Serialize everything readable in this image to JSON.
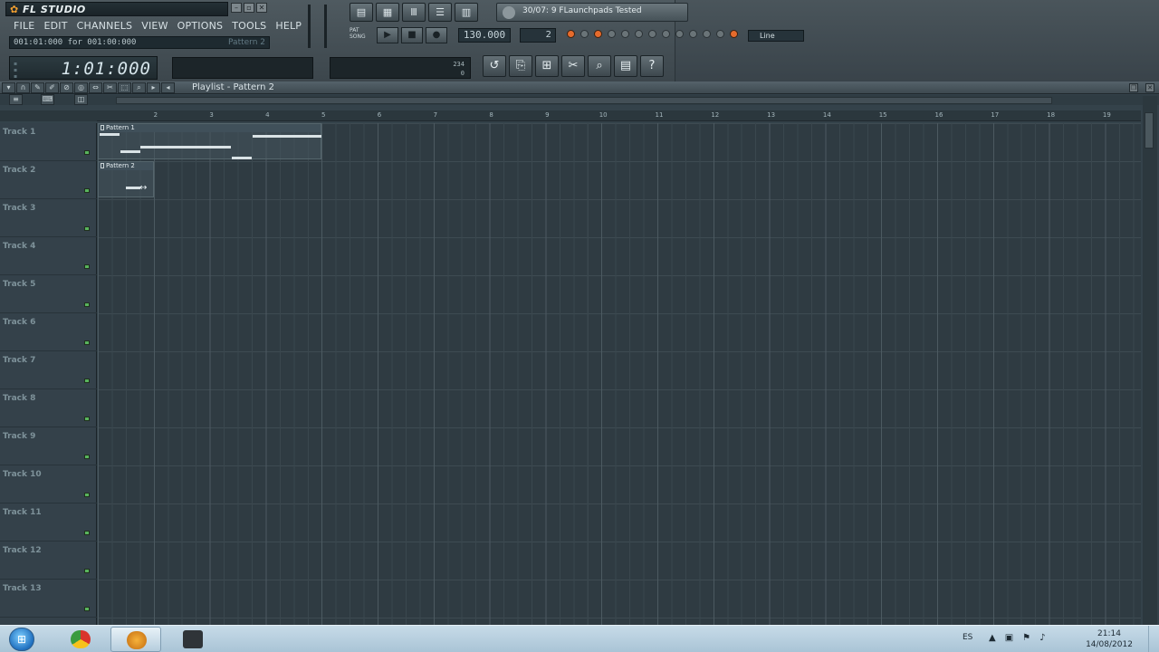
{
  "app": {
    "title": "FL STUDIO",
    "menu": [
      "FILE",
      "EDIT",
      "CHANNELS",
      "VIEW",
      "OPTIONS",
      "TOOLS",
      "HELP"
    ],
    "hint": "001:01:000 for 001:00:000",
    "hint_pattern": "Pattern 2",
    "time": "1:01:000",
    "song_title": "30/07: 9 FLaunchpads Tested",
    "tempo": "130.000",
    "pattern_number": "2",
    "snap": "Line",
    "cpu": "234",
    "cpu_val": "0"
  },
  "playlist": {
    "title": "Playlist - Pattern 2",
    "ruler": [
      "2",
      "3",
      "4",
      "5",
      "6",
      "7",
      "8",
      "9",
      "10",
      "11",
      "12",
      "13",
      "14",
      "15",
      "16",
      "17",
      "18",
      "19"
    ],
    "tracks": [
      "Track 1",
      "Track 2",
      "Track 3",
      "Track 4",
      "Track 5",
      "Track 6",
      "Track 7",
      "Track 8",
      "Track 9",
      "Track 10",
      "Track 11",
      "Track 12",
      "Track 13"
    ],
    "clips": [
      {
        "name": "Pattern 1",
        "track": 1
      },
      {
        "name": "Pattern 2",
        "track": 2
      }
    ]
  },
  "taskbar": {
    "language": "ES",
    "time": "21:14",
    "date": "14/08/2012"
  },
  "colors": {
    "accent": "#e66b2c",
    "grid_bg": "#2f3b42",
    "track_led": "#58b45c"
  }
}
